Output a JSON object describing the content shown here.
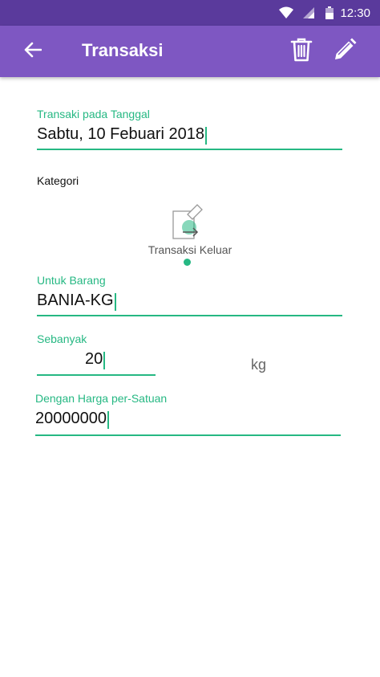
{
  "status_bar": {
    "time": "12:30"
  },
  "app_bar": {
    "title": "Transaksi"
  },
  "form": {
    "date": {
      "label": "Transaki pada Tanggal",
      "value": "Sabtu, 10 Febuari 2018"
    },
    "category": {
      "label": "Kategori",
      "selected": "Transaksi Keluar"
    },
    "item": {
      "label": "Untuk Barang",
      "value": "BANIA-KG"
    },
    "quantity": {
      "label": "Sebanyak",
      "value": "20",
      "unit": "kg"
    },
    "price": {
      "label": "Dengan Harga per-Satuan",
      "value": "20000000"
    }
  },
  "colors": {
    "status_bar": "#5a3a9c",
    "app_bar": "#7e57c2",
    "accent": "#26b883"
  },
  "icons": [
    "wifi-icon",
    "signal-icon",
    "battery-icon",
    "back-arrow-icon",
    "trash-icon",
    "pencil-icon",
    "transaction-out-icon"
  ]
}
